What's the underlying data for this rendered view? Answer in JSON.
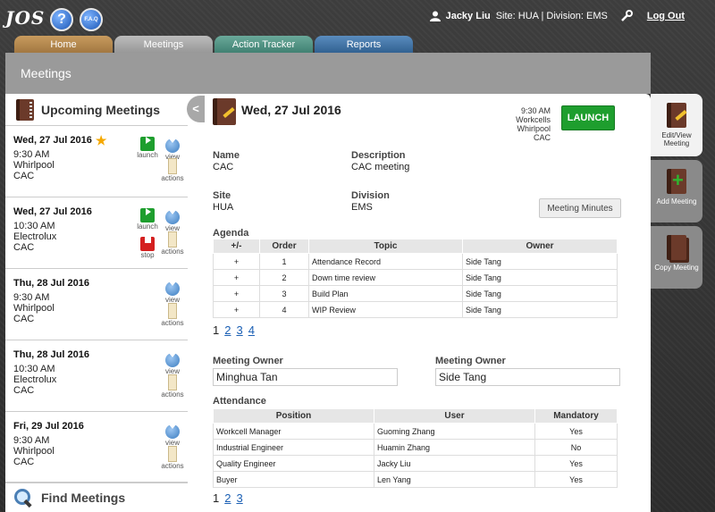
{
  "app": {
    "logo": "JOS",
    "help_icon": "?",
    "faq_icon": "F.A.Q"
  },
  "user": {
    "name": "Jacky Liu",
    "site_division": "Site: HUA | Division: EMS",
    "logout": "Log Out"
  },
  "tabs": [
    {
      "label": "Home"
    },
    {
      "label": "Meetings"
    },
    {
      "label": "Action Tracker"
    },
    {
      "label": "Reports"
    }
  ],
  "page_title": "Meetings",
  "upcoming": {
    "title": "Upcoming Meetings",
    "items": [
      {
        "date": "Wed, 27 Jul 2016",
        "time": "9:30 AM",
        "customer": "Whirlpool",
        "site": "CAC",
        "starred": true,
        "launch": "launch",
        "view": "view",
        "actions": "actions"
      },
      {
        "date": "Wed, 27 Jul 2016",
        "time": "10:30 AM",
        "customer": "Electrolux",
        "site": "CAC",
        "launch": "launch",
        "stop": "stop",
        "view": "view",
        "actions": "actions"
      },
      {
        "date": "Thu, 28 Jul 2016",
        "time": "9:30 AM",
        "customer": "Whirlpool",
        "site": "CAC",
        "view": "view",
        "actions": "actions"
      },
      {
        "date": "Thu, 28 Jul 2016",
        "time": "10:30 AM",
        "customer": "Electrolux",
        "site": "CAC",
        "view": "view",
        "actions": "actions"
      },
      {
        "date": "Fri, 29 Jul 2016",
        "time": "9:30 AM",
        "customer": "Whirlpool",
        "site": "CAC",
        "view": "view",
        "actions": "actions"
      }
    ],
    "find": "Find Meetings"
  },
  "collapse": "<",
  "meeting": {
    "date": "Wed, 27 Jul 2016",
    "info": {
      "time": "9:30 AM",
      "workcells": "Workcells",
      "customer": "Whirlpool",
      "site": "CAC"
    },
    "launch": "LAUNCH",
    "name_label": "Name",
    "name": "CAC",
    "description_label": "Description",
    "description": "CAC meeting",
    "site_label": "Site",
    "site": "HUA",
    "division_label": "Division",
    "division": "EMS",
    "minutes_button": "Meeting Minutes",
    "agenda_label": "Agenda",
    "agenda_headers": [
      "+/-",
      "Order",
      "Topic",
      "Owner"
    ],
    "agenda_rows": [
      [
        "+",
        "1",
        "Attendance Record",
        "Side Tang"
      ],
      [
        "+",
        "2",
        "Down time review",
        "Side Tang"
      ],
      [
        "+",
        "3",
        "Build Plan",
        "Side Tang"
      ],
      [
        "+",
        "4",
        "WIP Review",
        "Side Tang"
      ]
    ],
    "agenda_pages": [
      "1",
      "2",
      "3",
      "4"
    ],
    "owner1_label": "Meeting Owner",
    "owner1": "Minghua Tan",
    "owner2_label": "Meeting Owner",
    "owner2": "Side Tang",
    "attendance_label": "Attendance",
    "attendance_headers": [
      "Position",
      "User",
      "Mandatory"
    ],
    "attendance_rows": [
      [
        "Workcell Manager",
        "Guoming Zhang",
        "Yes"
      ],
      [
        "Industrial Engineer",
        "Huamin Zhang",
        "No"
      ],
      [
        "Quality Engineer",
        "Jacky Liu",
        "Yes"
      ],
      [
        "Buyer",
        "Len Yang",
        "Yes"
      ]
    ],
    "attendance_pages": [
      "1",
      "2",
      "3"
    ]
  },
  "side_nav": [
    {
      "label": "Edit/View Meeting",
      "icon": "edit-book-icon"
    },
    {
      "label": "Add Meeting",
      "icon": "add-book-icon"
    },
    {
      "label": "Copy Meeting",
      "icon": "copy-book-icon"
    }
  ],
  "colors": {
    "launch_green": "#1e9e2e",
    "stop_red": "#d42020",
    "link_blue": "#1a5fb4",
    "star": "#f5a800"
  }
}
